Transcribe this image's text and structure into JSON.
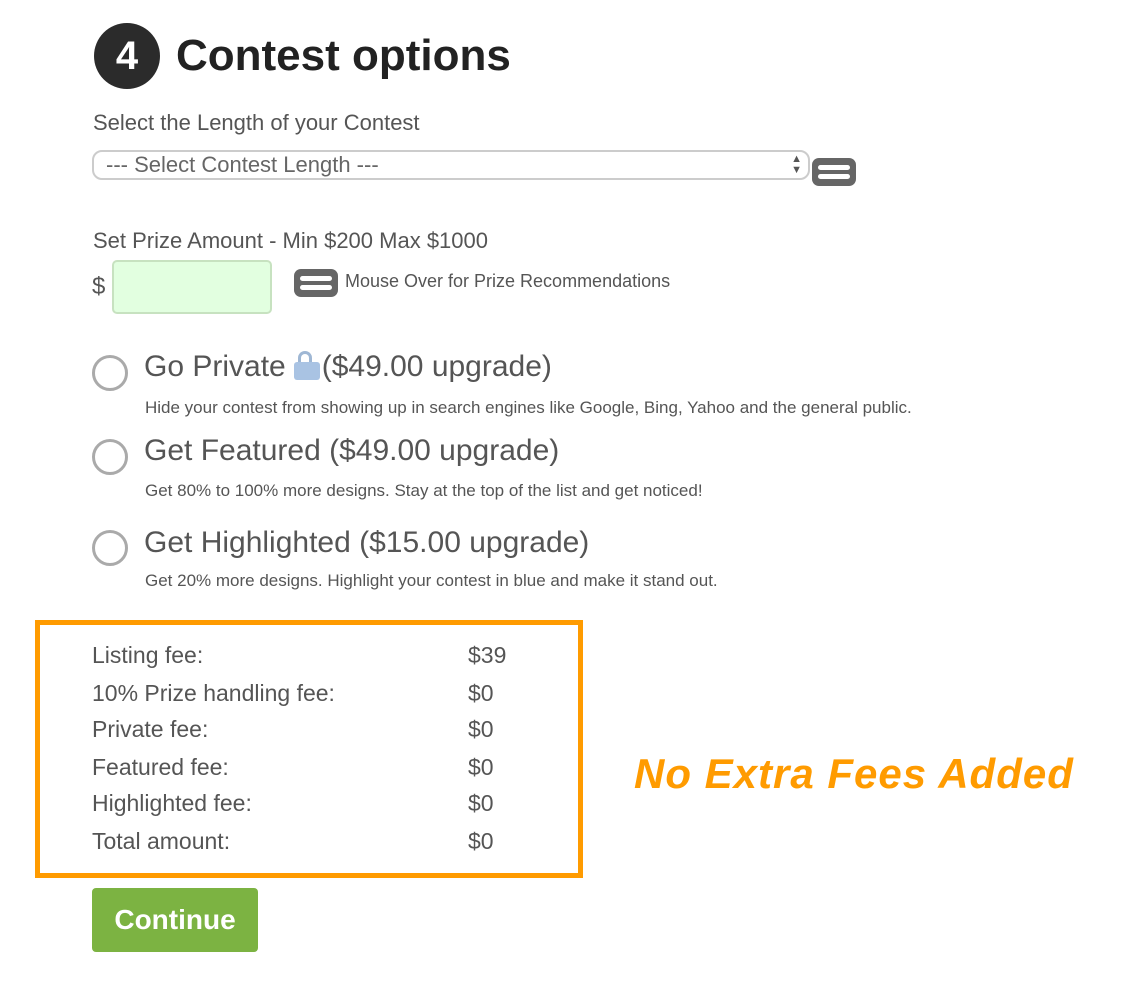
{
  "section": {
    "step_number": "4",
    "title": "Contest options"
  },
  "contest_length": {
    "label": "Select the Length of your Contest",
    "selected": "--- Select Contest Length ---"
  },
  "prize": {
    "label": "Set Prize Amount - Min $200 Max $1000",
    "currency": "$",
    "value": "",
    "hint": "Mouse Over for Prize Recommendations"
  },
  "options": [
    {
      "title_pre": "Go Private",
      "title_post": "($49.00 upgrade)",
      "description": "Hide your contest from showing up in search engines like Google, Bing, Yahoo and the general public.",
      "checked": false
    },
    {
      "title": "Get Featured ($49.00 upgrade)",
      "description": "Get 80% to 100% more designs. Stay at the top of the list and get noticed!",
      "checked": false
    },
    {
      "title": "Get Highlighted ($15.00 upgrade)",
      "description": "Get 20% more designs. Highlight your contest in blue and make it stand out.",
      "checked": false
    }
  ],
  "fees": [
    {
      "label": "Listing fee:",
      "value": "$39"
    },
    {
      "label": "10% Prize handling fee:",
      "value": "$0"
    },
    {
      "label": "Private fee:",
      "value": "$0"
    },
    {
      "label": "Featured fee:",
      "value": "$0"
    },
    {
      "label": "Highlighted fee:",
      "value": "$0"
    },
    {
      "label": "Total amount:",
      "value": "$0"
    }
  ],
  "annotation": "No Extra Fees Added",
  "continue_label": "Continue",
  "colors": {
    "highlight_orange": "#ff9b00",
    "button_green": "#7cb342",
    "input_green": "#e2ffe0"
  },
  "icons": {
    "help": "info-bars-icon",
    "lock": "lock-icon"
  }
}
